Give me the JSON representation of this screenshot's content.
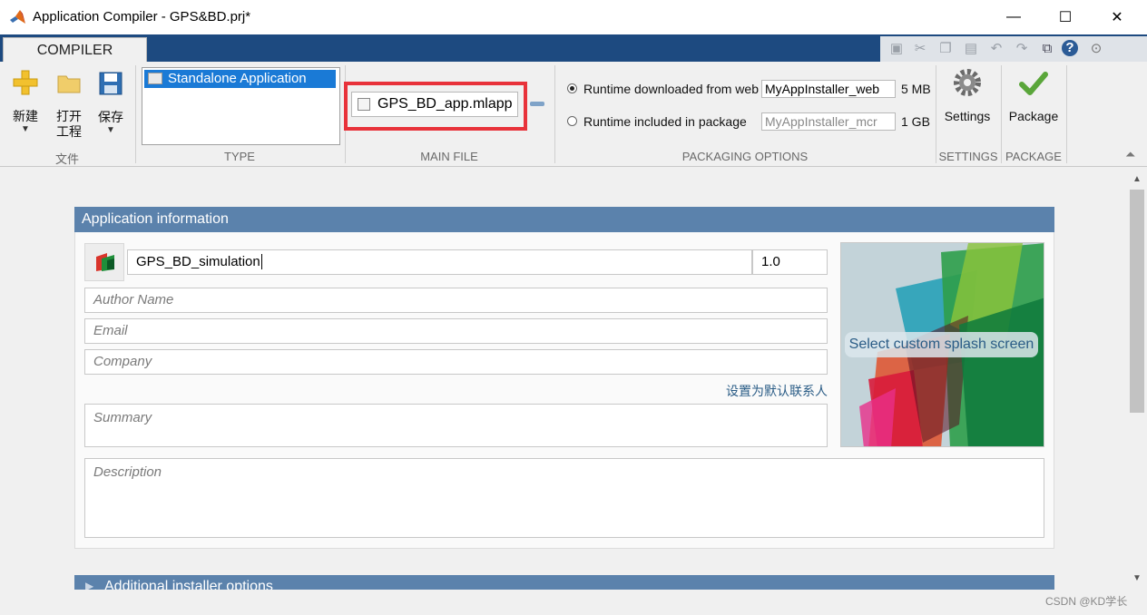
{
  "window": {
    "title": "Application Compiler - GPS&BD.prj*",
    "minimize": "—",
    "maximize": "☐",
    "close": "✕"
  },
  "ribbon": {
    "tab": "COMPILER",
    "file_group": {
      "label": "文件",
      "new_label": "新建",
      "open_label_1": "打开",
      "open_label_2": "工程",
      "save_label": "保存"
    },
    "type_group": {
      "label": "TYPE",
      "selected": "Standalone Application"
    },
    "mainfile_group": {
      "label": "MAIN FILE",
      "file": "GPS_BD_app.mlapp"
    },
    "packaging_group": {
      "label": "PACKAGING OPTIONS",
      "web_option_label": "Runtime downloaded from web",
      "web_installer_name": "MyAppInstaller_web",
      "web_size": "5 MB",
      "pkg_option_label": "Runtime included in package",
      "pkg_installer_name": "MyAppInstaller_mcr",
      "pkg_size": "1 GB"
    },
    "settings_group": {
      "label": "SETTINGS",
      "button": "Settings"
    },
    "package_group": {
      "label": "PACKAGE",
      "button": "Package"
    }
  },
  "app_info": {
    "header": "Application information",
    "app_name": "GPS_BD_simulation",
    "version": "1.0",
    "author_placeholder": "Author Name",
    "email_placeholder": "Email",
    "company_placeholder": "Company",
    "set_default_link": "设置为默认联系人",
    "summary_placeholder": "Summary",
    "description_placeholder": "Description",
    "splash_button": "Select custom splash screen"
  },
  "additional_section": {
    "header": "Additional installer options"
  },
  "watermark": "CSDN @KD学长",
  "colors": {
    "ribbon_header": "#1d4a80",
    "section_header": "#5b82ac",
    "selection": "#1a7ad6",
    "highlight_box": "#e8323a",
    "link": "#2a5c86"
  }
}
